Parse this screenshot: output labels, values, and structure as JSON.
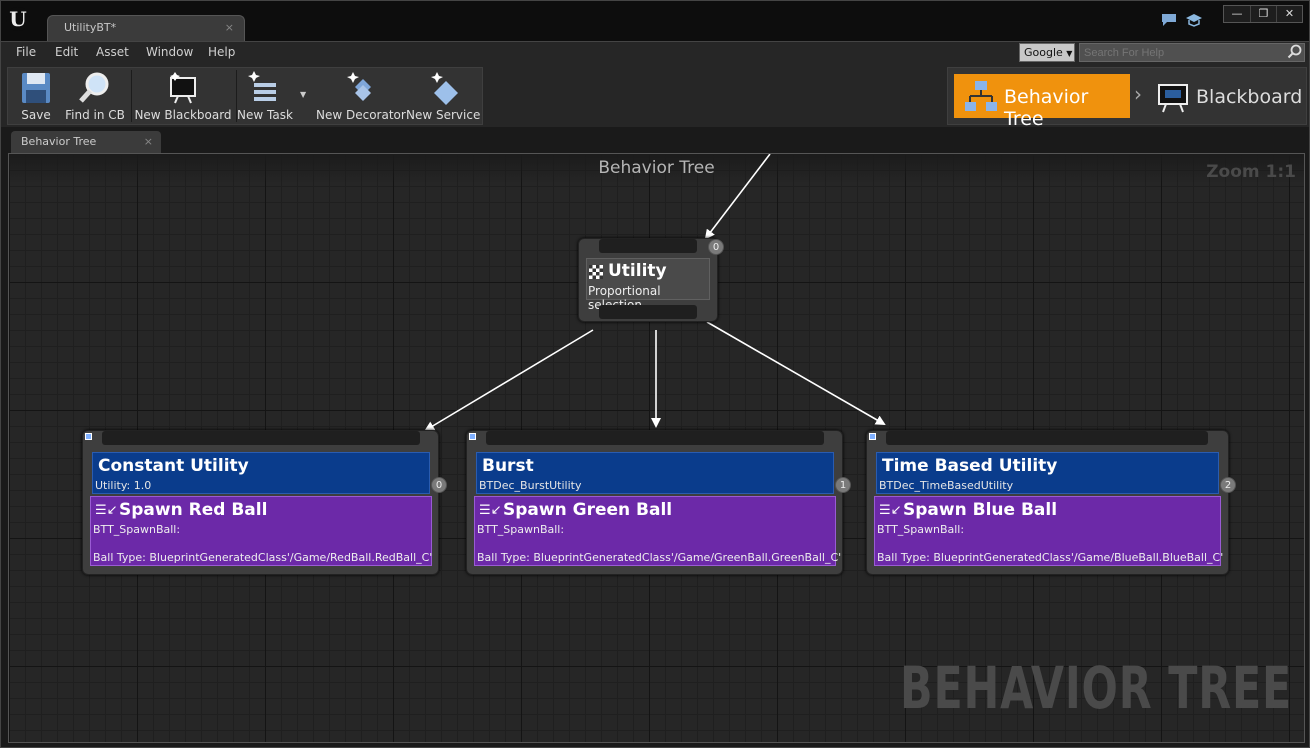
{
  "window": {
    "tab_title": "UtilityBT*",
    "tab_close": "×",
    "controls": [
      "—",
      "❐",
      "✕"
    ]
  },
  "menu": [
    "File",
    "Edit",
    "Asset",
    "Window",
    "Help"
  ],
  "search": {
    "engine": "Google",
    "placeholder": "Search For Help"
  },
  "toolbar": [
    {
      "label": "Save",
      "icon": "save-icon"
    },
    {
      "label": "Find in CB",
      "icon": "magnifier-icon"
    },
    {
      "label": "New Blackboard",
      "icon": "blackboard-icon"
    },
    {
      "label": "New Task",
      "icon": "task-icon"
    },
    {
      "label": "New Decorator",
      "icon": "decorator-icon"
    },
    {
      "label": "New Service",
      "icon": "service-icon"
    }
  ],
  "modes": {
    "active": "Behavior Tree",
    "inactive": "Blackboard"
  },
  "panel_tab": {
    "label": "Behavior Tree",
    "close": "×"
  },
  "graph": {
    "title": "Behavior Tree",
    "zoom": "Zoom 1:1",
    "watermark": "BEHAVIOR TREE",
    "root": {
      "title": "Utility",
      "subtitle": "Proportional selection",
      "index": "0"
    },
    "children": [
      {
        "decorator_title": "Constant Utility",
        "decorator_sub": "Utility: 1.0",
        "index": "0",
        "task_title": "Spawn Red Ball",
        "task_sub": "BTT_SpawnBall:",
        "task_param": "Ball Type: BlueprintGeneratedClass'/Game/RedBall.RedBall_C'"
      },
      {
        "decorator_title": "Burst",
        "decorator_sub": "BTDec_BurstUtility",
        "index": "1",
        "task_title": "Spawn Green Ball",
        "task_sub": "BTT_SpawnBall:",
        "task_param": "Ball Type: BlueprintGeneratedClass'/Game/GreenBall.GreenBall_C'"
      },
      {
        "decorator_title": "Time Based Utility",
        "decorator_sub": "BTDec_TimeBasedUtility",
        "index": "2",
        "task_title": "Spawn Blue Ball",
        "task_sub": "BTT_SpawnBall:",
        "task_param": "Ball Type: BlueprintGeneratedClass'/Game/BlueBall.BlueBall_C'"
      }
    ]
  },
  "colors": {
    "accent_orange": "#f0920d",
    "decorator_blue": "#0a3c8c",
    "task_purple": "#6c29a8"
  }
}
